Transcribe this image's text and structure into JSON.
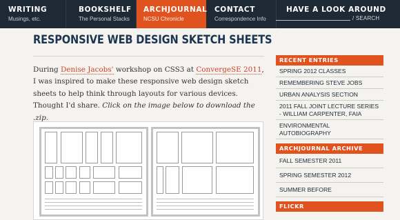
{
  "nav": [
    {
      "title": "WRITING",
      "subtitle": "Musings, etc."
    },
    {
      "title": "BOOKSHELF",
      "subtitle": "The Personal Stacks"
    },
    {
      "title": "ARCHJOURNAL",
      "subtitle": "NCSU Chronicle",
      "active": true
    },
    {
      "title": "CONTACT",
      "subtitle": "Correspondence Info"
    },
    {
      "title": "HAVE A LOOK AROUND",
      "subtitle": ""
    }
  ],
  "search": {
    "label": "/ SEARCH"
  },
  "article": {
    "title": "RESPONSIVE WEB DESIGN SKETCH SHEETS",
    "intro_1": "During ",
    "link_1": "Denise Jacobs'",
    "intro_2": " workshop on CSS3 at ",
    "link_2": "ConvergeSE 2011",
    "intro_3": ", I was inspired to make these responsive web design sketch sheets to help think through layouts for various devices. Thought I'd share. ",
    "intro_em": "Click on the image below to download the .zip."
  },
  "sidebar": {
    "recent_heading": "RECENT ENTRIES",
    "recent": [
      "SPRING 2012 CLASSES",
      "REMEMBERING STEVE JOBS",
      "URBAN ANALYSIS SECTION",
      "2011 FALL JOINT LECTURE SERIES - WILLIAM CARPENTER, FAIA",
      "ENVIRONMENTAL AUTOBIOGRAPHY"
    ],
    "archive_heading": "ARCHJOURNAL ARCHIVE",
    "archive": [
      "FALL SEMESTER 2011",
      "SPRING SEMESTER 2012",
      "SUMMER BEFORE"
    ],
    "flickr_heading": "FLICKR"
  },
  "colors": {
    "accent": "#e0521e",
    "nav_bg": "#1d2a36",
    "title": "#1d3550",
    "link": "#c8462a"
  }
}
